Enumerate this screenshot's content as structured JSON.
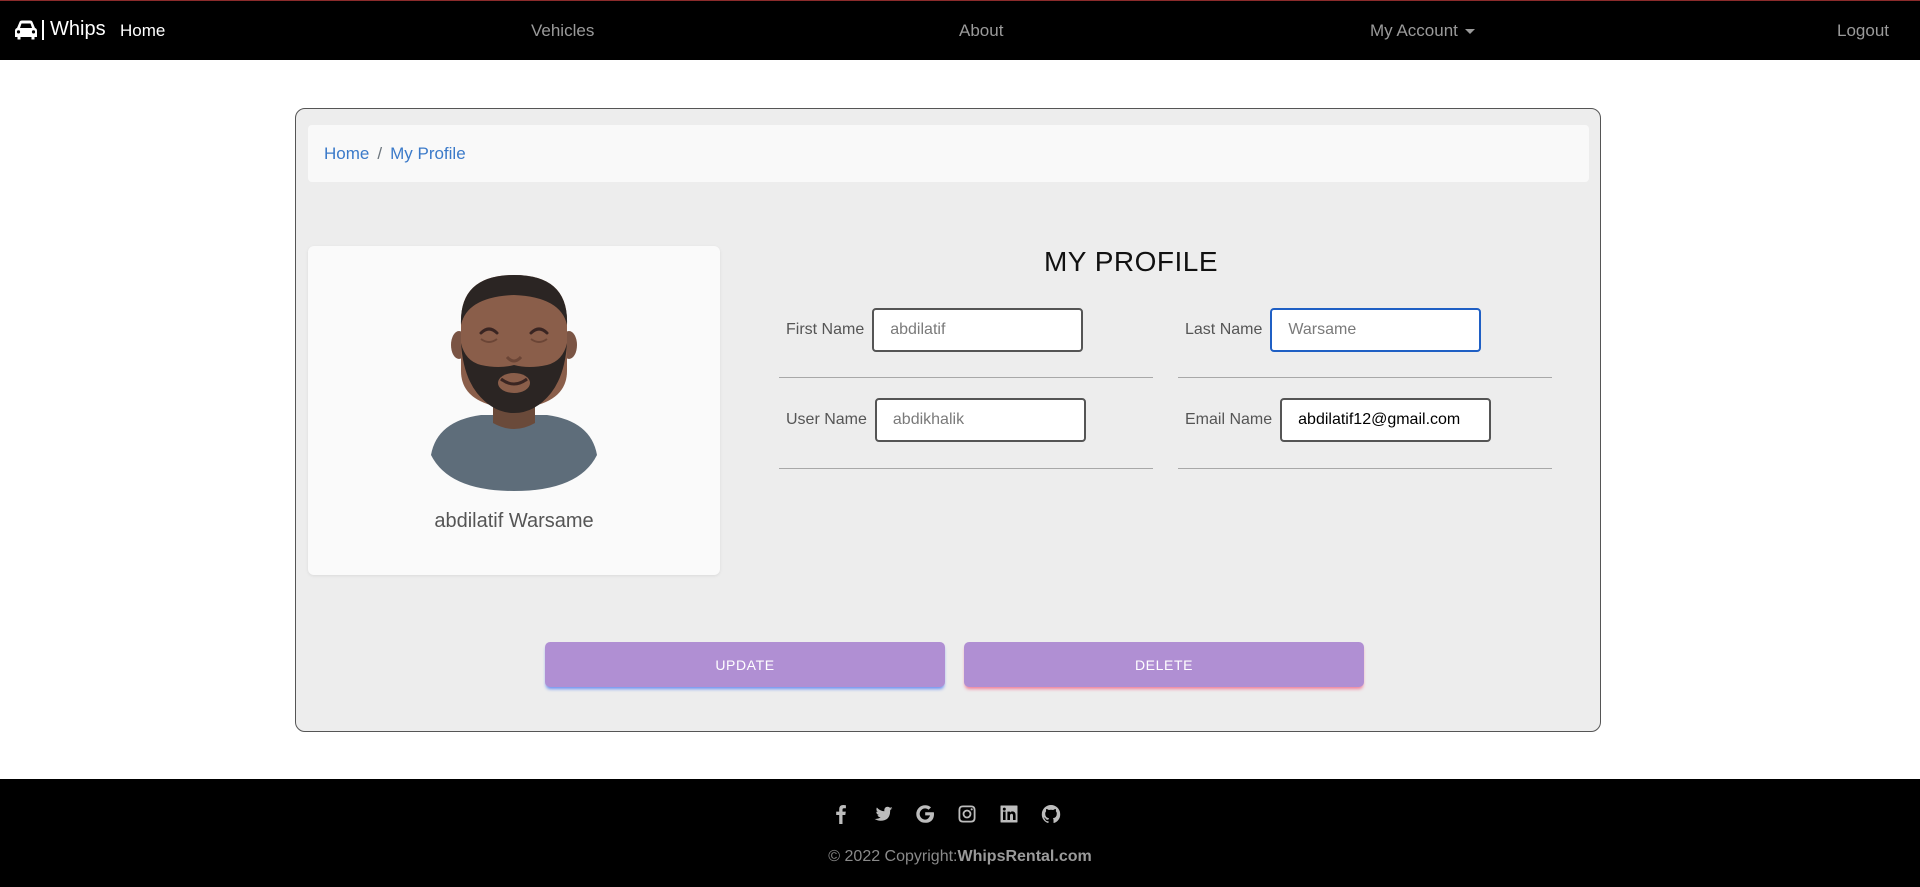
{
  "nav": {
    "brand": "Whips",
    "home": "Home",
    "vehicles": "Vehicles",
    "about": "About",
    "account": "My Account",
    "logout": "Logout"
  },
  "breadcrumb": {
    "home": "Home",
    "separator": "/",
    "current": "My Profile"
  },
  "profile": {
    "name": "abdilatif Warsame",
    "title": "MY PROFILE"
  },
  "form": {
    "first_name_label": "First Name",
    "first_name_placeholder": "abdilatif",
    "last_name_label": "Last Name",
    "last_name_placeholder": "Warsame",
    "user_name_label": "User Name",
    "user_name_placeholder": "abdikhalik",
    "email_label": "Email Name",
    "email_value": "abdilatif12@gmail.com"
  },
  "buttons": {
    "update": "UPDATE",
    "delete": "DELETE"
  },
  "footer": {
    "copyright_prefix": "© 2022 Copyright:",
    "copyright_site": "WhipsRental.com",
    "icons": [
      "facebook-icon",
      "twitter-icon",
      "google-icon",
      "instagram-icon",
      "linkedin-icon",
      "github-icon"
    ]
  },
  "colors": {
    "navbar": "#000000",
    "card_bg": "#ededed",
    "button": "#b08fd3",
    "link": "#3b7ac9",
    "focus_border": "#1f5fc4"
  }
}
